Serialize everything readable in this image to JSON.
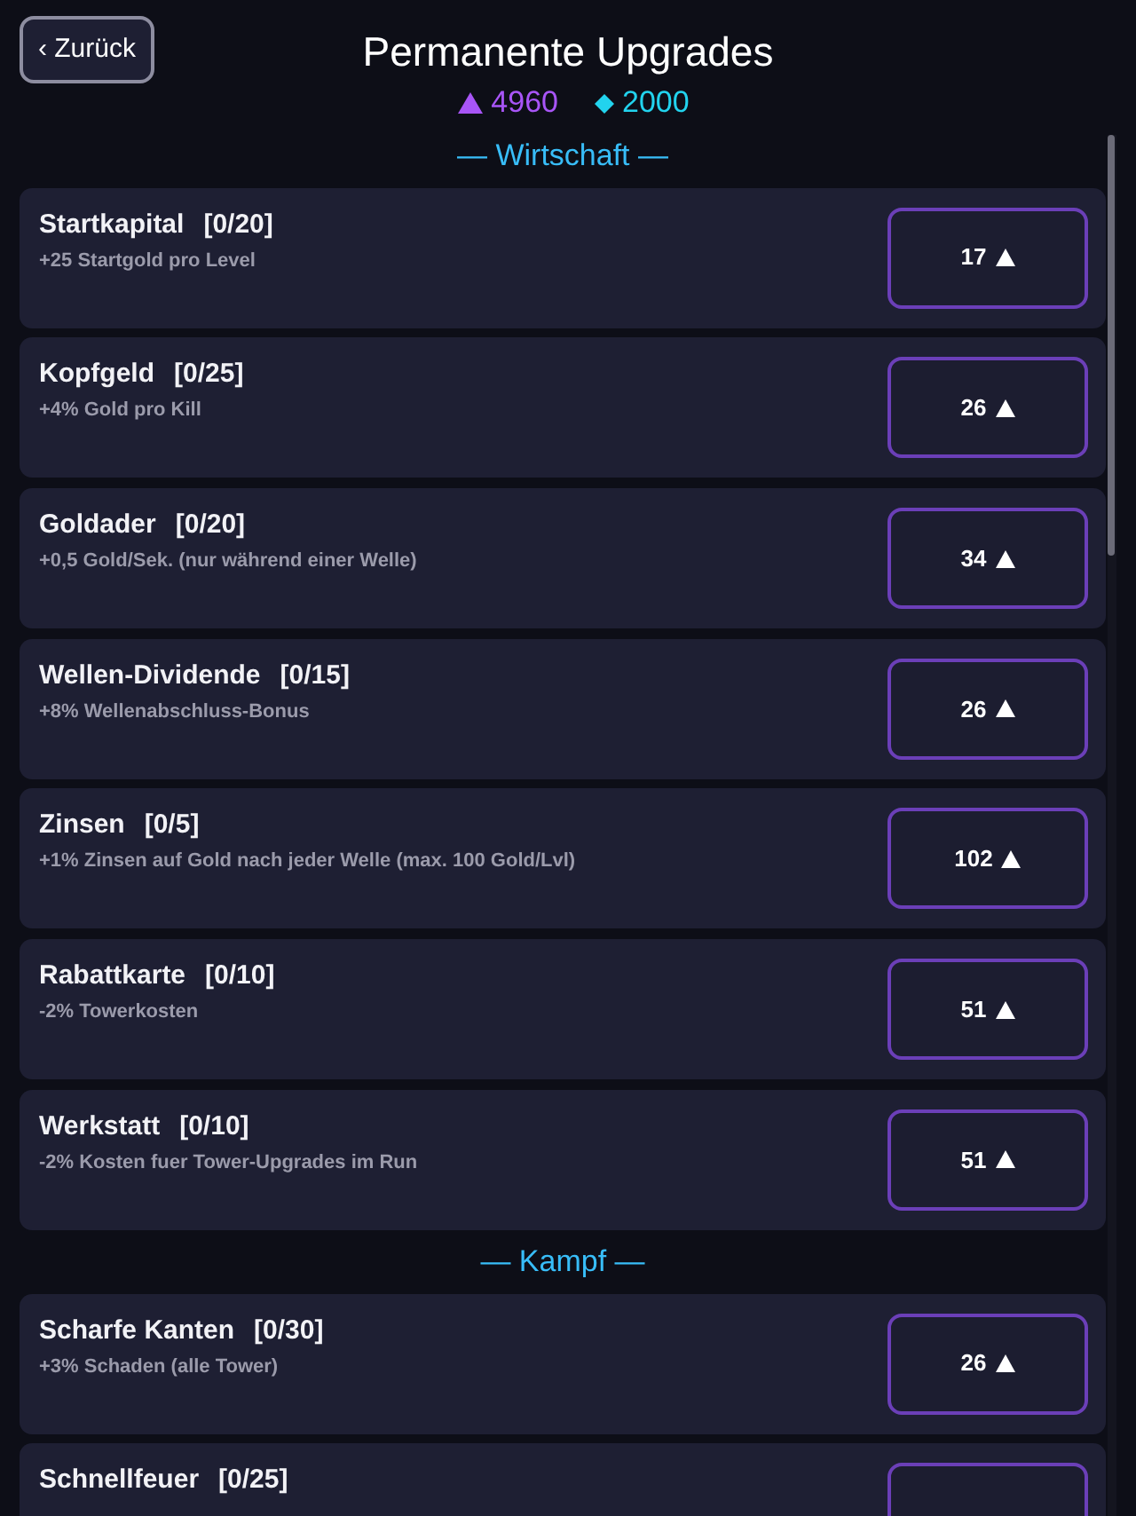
{
  "header": {
    "back_button": "‹ Zurück",
    "title": "Permanente Upgrades"
  },
  "currencies": [
    {
      "kind": "triangle",
      "amount": "4960",
      "color": "#a855f7"
    },
    {
      "kind": "diamond",
      "amount": "2000",
      "color": "#22d3ee"
    }
  ],
  "sections": [
    {
      "title": "— Wirtschaft —",
      "upgrades": [
        {
          "name": "Startkapital",
          "rank": "[0/20]",
          "desc": "+25 Startgold pro Level",
          "price": "17"
        },
        {
          "name": "Kopfgeld",
          "rank": "[0/25]",
          "desc": "+4% Gold pro Kill",
          "price": "26"
        },
        {
          "name": "Goldader",
          "rank": "[0/20]",
          "desc": "+0,5 Gold/Sek. (nur während einer Welle)",
          "price": "34"
        },
        {
          "name": "Wellen-Dividende",
          "rank": "[0/15]",
          "desc": "+8% Wellenabschluss-Bonus",
          "price": "26"
        },
        {
          "name": "Zinsen",
          "rank": "[0/5]",
          "desc": "+1% Zinsen auf Gold nach jeder Welle (max. 100 Gold/Lvl)",
          "price": "102"
        },
        {
          "name": "Rabattkarte",
          "rank": "[0/10]",
          "desc": "-2% Towerkosten",
          "price": "51"
        },
        {
          "name": "Werkstatt",
          "rank": "[0/10]",
          "desc": "-2% Kosten fuer Tower-Upgrades im Run",
          "price": "51"
        }
      ]
    },
    {
      "title": "— Kampf —",
      "upgrades": [
        {
          "name": "Scharfe Kanten",
          "rank": "[0/30]",
          "desc": "+3% Schaden (alle Tower)",
          "price": "26"
        },
        {
          "name": "Schnellfeuer",
          "rank": "[0/25]"
        }
      ]
    }
  ]
}
